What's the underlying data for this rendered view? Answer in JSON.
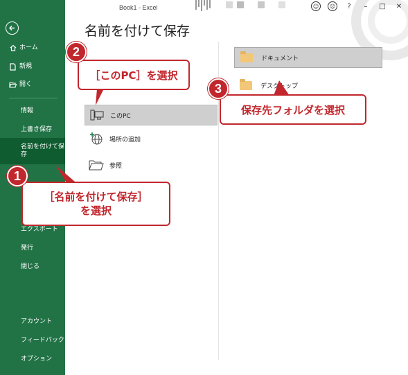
{
  "window": {
    "title": "Book1  -  Excel",
    "controls": [
      "smiley-icon",
      "frown-icon",
      "?",
      "minimize",
      "maximize",
      "close"
    ]
  },
  "sidebar": {
    "items": [
      {
        "label": "ホーム",
        "icon": "home-icon"
      },
      {
        "label": "新規",
        "icon": "new-document-icon"
      },
      {
        "label": "開く",
        "icon": "open-folder-icon"
      },
      {
        "label": "情報"
      },
      {
        "label": "上書き保存"
      },
      {
        "label": "名前を付けて保存",
        "selected": true
      },
      {
        "label": "エクスポート"
      },
      {
        "label": "発行"
      },
      {
        "label": "閉じる"
      },
      {
        "label": "アカウント"
      },
      {
        "label": "フィードバック"
      },
      {
        "label": "オプション"
      }
    ],
    "selected_label_line1": "名前を付けて保",
    "selected_label_line2": "存"
  },
  "main": {
    "title": "名前を付けて保存",
    "locations": [
      {
        "label": "このPC",
        "icon": "pc-icon",
        "selected": true
      },
      {
        "label": "場所の追加",
        "icon": "add-location-globe-icon"
      },
      {
        "label": "参照",
        "icon": "browse-folder-icon"
      }
    ],
    "folders": [
      {
        "label": "ドキュメント",
        "selected": true
      },
      {
        "label": "デスクトップ"
      }
    ]
  },
  "callouts": [
    {
      "number": "1",
      "text_line1": "［名前を付けて保存］",
      "text_line2": "を選択"
    },
    {
      "number": "2",
      "text": "［このPC］を選択"
    },
    {
      "number": "3",
      "text": "保存先フォルダを選択"
    }
  ],
  "colors": {
    "sidebar": "#217346",
    "sidebar_selected": "#0e5c2f",
    "accent_red": "#c1272d",
    "folder": "#f2c777"
  }
}
